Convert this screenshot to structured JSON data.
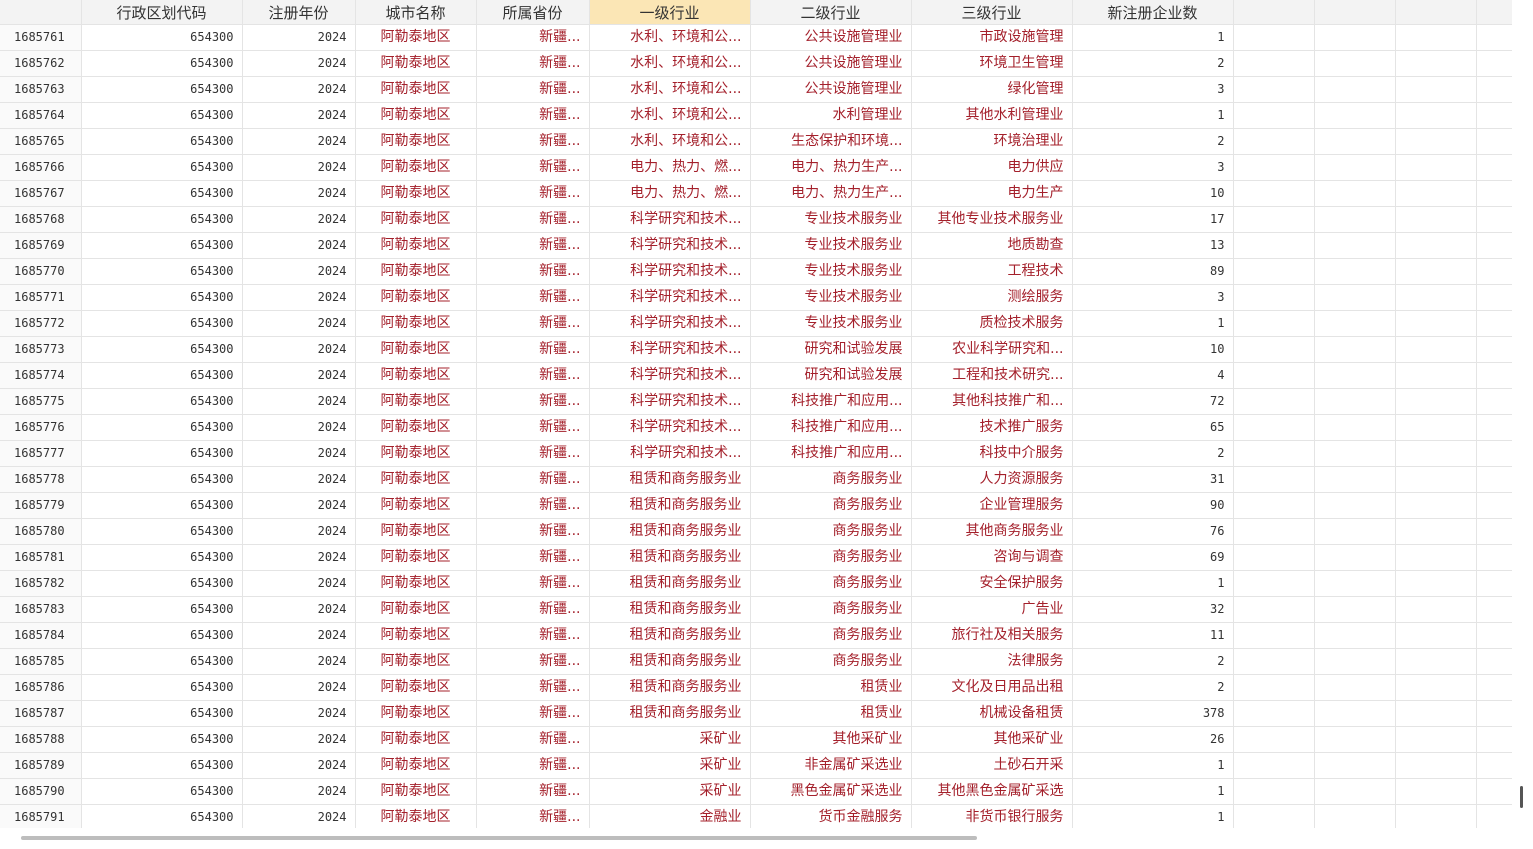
{
  "headers": [
    "",
    "行政区划代码",
    "注册年份",
    "城市名称",
    "所属省份",
    "一级行业",
    "二级行业",
    "三级行业",
    "新注册企业数",
    "",
    "",
    "",
    ""
  ],
  "rows": [
    [
      "1685761",
      "654300",
      "2024",
      "阿勒泰地区",
      "新疆...",
      "水利、环境和公...",
      "公共设施管理业",
      "市政设施管理",
      "1"
    ],
    [
      "1685762",
      "654300",
      "2024",
      "阿勒泰地区",
      "新疆...",
      "水利、环境和公...",
      "公共设施管理业",
      "环境卫生管理",
      "2"
    ],
    [
      "1685763",
      "654300",
      "2024",
      "阿勒泰地区",
      "新疆...",
      "水利、环境和公...",
      "公共设施管理业",
      "绿化管理",
      "3"
    ],
    [
      "1685764",
      "654300",
      "2024",
      "阿勒泰地区",
      "新疆...",
      "水利、环境和公...",
      "水利管理业",
      "其他水利管理业",
      "1"
    ],
    [
      "1685765",
      "654300",
      "2024",
      "阿勒泰地区",
      "新疆...",
      "水利、环境和公...",
      "生态保护和环境...",
      "环境治理业",
      "2"
    ],
    [
      "1685766",
      "654300",
      "2024",
      "阿勒泰地区",
      "新疆...",
      "电力、热力、燃...",
      "电力、热力生产...",
      "电力供应",
      "3"
    ],
    [
      "1685767",
      "654300",
      "2024",
      "阿勒泰地区",
      "新疆...",
      "电力、热力、燃...",
      "电力、热力生产...",
      "电力生产",
      "10"
    ],
    [
      "1685768",
      "654300",
      "2024",
      "阿勒泰地区",
      "新疆...",
      "科学研究和技术...",
      "专业技术服务业",
      "其他专业技术服务业",
      "17"
    ],
    [
      "1685769",
      "654300",
      "2024",
      "阿勒泰地区",
      "新疆...",
      "科学研究和技术...",
      "专业技术服务业",
      "地质勘查",
      "13"
    ],
    [
      "1685770",
      "654300",
      "2024",
      "阿勒泰地区",
      "新疆...",
      "科学研究和技术...",
      "专业技术服务业",
      "工程技术",
      "89"
    ],
    [
      "1685771",
      "654300",
      "2024",
      "阿勒泰地区",
      "新疆...",
      "科学研究和技术...",
      "专业技术服务业",
      "测绘服务",
      "3"
    ],
    [
      "1685772",
      "654300",
      "2024",
      "阿勒泰地区",
      "新疆...",
      "科学研究和技术...",
      "专业技术服务业",
      "质检技术服务",
      "1"
    ],
    [
      "1685773",
      "654300",
      "2024",
      "阿勒泰地区",
      "新疆...",
      "科学研究和技术...",
      "研究和试验发展",
      "农业科学研究和...",
      "10"
    ],
    [
      "1685774",
      "654300",
      "2024",
      "阿勒泰地区",
      "新疆...",
      "科学研究和技术...",
      "研究和试验发展",
      "工程和技术研究...",
      "4"
    ],
    [
      "1685775",
      "654300",
      "2024",
      "阿勒泰地区",
      "新疆...",
      "科学研究和技术...",
      "科技推广和应用...",
      "其他科技推广和...",
      "72"
    ],
    [
      "1685776",
      "654300",
      "2024",
      "阿勒泰地区",
      "新疆...",
      "科学研究和技术...",
      "科技推广和应用...",
      "技术推广服务",
      "65"
    ],
    [
      "1685777",
      "654300",
      "2024",
      "阿勒泰地区",
      "新疆...",
      "科学研究和技术...",
      "科技推广和应用...",
      "科技中介服务",
      "2"
    ],
    [
      "1685778",
      "654300",
      "2024",
      "阿勒泰地区",
      "新疆...",
      "租赁和商务服务业",
      "商务服务业",
      "人力资源服务",
      "31"
    ],
    [
      "1685779",
      "654300",
      "2024",
      "阿勒泰地区",
      "新疆...",
      "租赁和商务服务业",
      "商务服务业",
      "企业管理服务",
      "90"
    ],
    [
      "1685780",
      "654300",
      "2024",
      "阿勒泰地区",
      "新疆...",
      "租赁和商务服务业",
      "商务服务业",
      "其他商务服务业",
      "76"
    ],
    [
      "1685781",
      "654300",
      "2024",
      "阿勒泰地区",
      "新疆...",
      "租赁和商务服务业",
      "商务服务业",
      "咨询与调查",
      "69"
    ],
    [
      "1685782",
      "654300",
      "2024",
      "阿勒泰地区",
      "新疆...",
      "租赁和商务服务业",
      "商务服务业",
      "安全保护服务",
      "1"
    ],
    [
      "1685783",
      "654300",
      "2024",
      "阿勒泰地区",
      "新疆...",
      "租赁和商务服务业",
      "商务服务业",
      "广告业",
      "32"
    ],
    [
      "1685784",
      "654300",
      "2024",
      "阿勒泰地区",
      "新疆...",
      "租赁和商务服务业",
      "商务服务业",
      "旅行社及相关服务",
      "11"
    ],
    [
      "1685785",
      "654300",
      "2024",
      "阿勒泰地区",
      "新疆...",
      "租赁和商务服务业",
      "商务服务业",
      "法律服务",
      "2"
    ],
    [
      "1685786",
      "654300",
      "2024",
      "阿勒泰地区",
      "新疆...",
      "租赁和商务服务业",
      "租赁业",
      "文化及日用品出租",
      "2"
    ],
    [
      "1685787",
      "654300",
      "2024",
      "阿勒泰地区",
      "新疆...",
      "租赁和商务服务业",
      "租赁业",
      "机械设备租赁",
      "378"
    ],
    [
      "1685788",
      "654300",
      "2024",
      "阿勒泰地区",
      "新疆...",
      "采矿业",
      "其他采矿业",
      "其他采矿业",
      "26"
    ],
    [
      "1685789",
      "654300",
      "2024",
      "阿勒泰地区",
      "新疆...",
      "采矿业",
      "非金属矿采选业",
      "土砂石开采",
      "1"
    ],
    [
      "1685790",
      "654300",
      "2024",
      "阿勒泰地区",
      "新疆...",
      "采矿业",
      "黑色金属矿采选业",
      "其他黑色金属矿采选",
      "1"
    ],
    [
      "1685791",
      "654300",
      "2024",
      "阿勒泰地区",
      "新疆...",
      "金融业",
      "货币金融服务",
      "非货币银行服务",
      "1"
    ]
  ],
  "sorted_column_index": 5,
  "colors": {
    "text_red": "#a4202b",
    "sorted_header": "#fbe6b5",
    "header_bg": "#f3f3f3"
  }
}
